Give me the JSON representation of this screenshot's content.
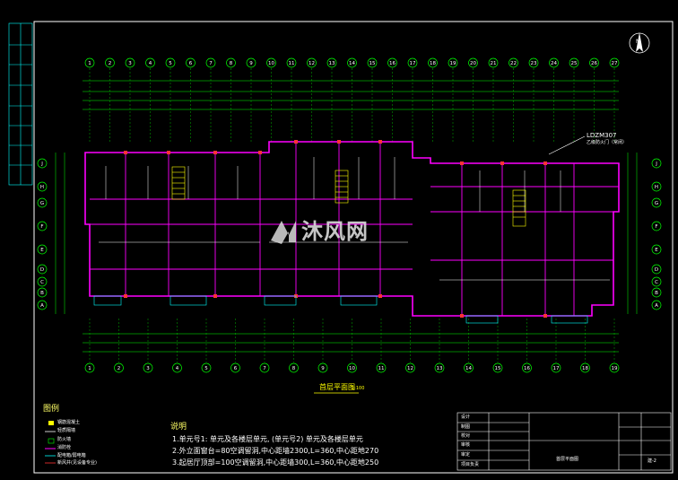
{
  "drawing": {
    "plan_title": "首层平面图",
    "scale": "1:100",
    "north_label": "N",
    "colors": {
      "background": "#000000",
      "walls": "#ff00ff",
      "axis": "#00ff00",
      "dimension": "#00ffff",
      "text": "#ffffff",
      "title": "#ffff00"
    }
  },
  "callout": {
    "tag": "LDZM307",
    "sub": "乙级防火门（常闭）"
  },
  "watermark": {
    "brand": "沐风网"
  },
  "legend": {
    "title": "图例",
    "items": [
      "钢筋混凝土",
      "轻质隔墙",
      "防火墙",
      "消防栓",
      "配电箱/弱电箱",
      "新风井(见设备专业)"
    ]
  },
  "notes": {
    "title": "说明",
    "lines": [
      "1.单元号1: 单元及各楼层单元, (单元号2) 单元及各楼层单元",
      "2.外立面窗台=80空调留洞,中心距墙2300,L=360,中心距地270",
      "3.起居厅顶部=100空调留洞,中心距墙300,L=360,中心距地250"
    ]
  },
  "axes": {
    "top": [
      "1",
      "2",
      "3",
      "4",
      "5",
      "6",
      "7",
      "8",
      "9",
      "10",
      "11",
      "12",
      "13",
      "14",
      "15",
      "16",
      "17",
      "18",
      "19",
      "20",
      "21",
      "22",
      "23",
      "24",
      "25",
      "26",
      "27"
    ],
    "bottom": [
      "1",
      "2",
      "3",
      "4",
      "5",
      "6",
      "7",
      "8",
      "9",
      "10",
      "11",
      "12",
      "13",
      "14",
      "15",
      "16",
      "17",
      "18",
      "19"
    ],
    "left": [
      "J",
      "H",
      "G",
      "F",
      "E",
      "D",
      "C",
      "B",
      "A"
    ],
    "right": [
      "J",
      "H",
      "G",
      "F",
      "E",
      "D",
      "C",
      "B",
      "A"
    ]
  },
  "title_block": {
    "rows": [
      "设计",
      "制图",
      "校对",
      "审核",
      "审定",
      "项目负责"
    ],
    "drawing_name": "首层平面图",
    "sheet_no": "建-2"
  }
}
